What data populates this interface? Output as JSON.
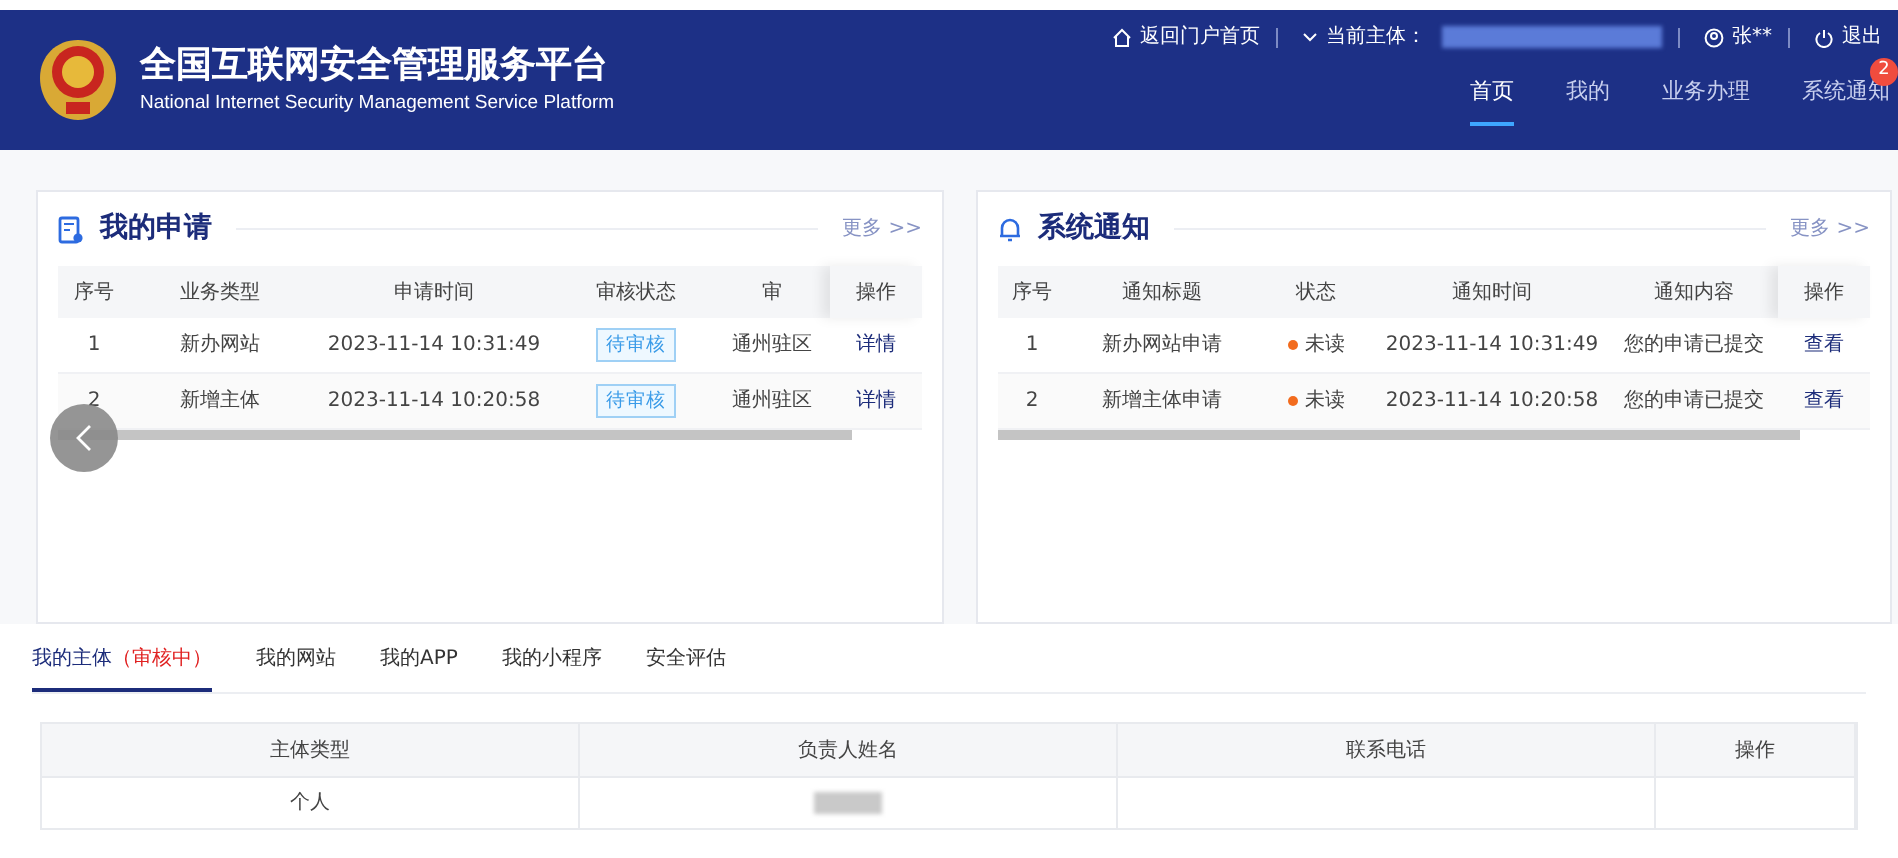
{
  "header": {
    "title": "全国互联网安全管理服务平台",
    "subtitle": "National Internet Security Management Service Platform",
    "top_links": [
      {
        "kind": "home",
        "label": "返回门户首页"
      },
      {
        "kind": "subject",
        "label": "当前主体："
      },
      {
        "kind": "user",
        "label": "张**"
      },
      {
        "kind": "logout",
        "label": "退出"
      }
    ],
    "nav": [
      {
        "label": "首页",
        "selected": true
      },
      {
        "label": "我的",
        "selected": false
      },
      {
        "label": "业务办理",
        "selected": false
      },
      {
        "label": "系统通知",
        "selected": false,
        "badge": "2"
      }
    ]
  },
  "applications": {
    "title": "我的申请",
    "more": "更多 >>",
    "columns": [
      "序号",
      "业务类型",
      "申请时间",
      "审核状态",
      "审",
      "操作"
    ],
    "rows": [
      {
        "cells": [
          "1",
          "新办网站",
          "2023-11-14 10:31:49",
          "待审核",
          "通州驻区",
          "详情"
        ]
      },
      {
        "cells": [
          "2",
          "新增主体",
          "2023-11-14 10:20:58",
          "待审核",
          "通州驻区",
          "详情"
        ]
      }
    ]
  },
  "notices": {
    "title": "系统通知",
    "more": "更多 >>",
    "columns": [
      "序号",
      "通知标题",
      "状态",
      "通知时间",
      "通知内容",
      "操作"
    ],
    "rows": [
      {
        "cells": [
          "1",
          "新办网站申请",
          "未读",
          "2023-11-14 10:31:49",
          "您的申请已提交",
          "查看"
        ],
        "color": "#f26b1d"
      },
      {
        "cells": [
          "2",
          "新增主体申请",
          "未读",
          "2023-11-14 10:20:58",
          "您的申请已提交",
          "查看"
        ],
        "color": "#f26b1d"
      }
    ]
  },
  "tabs": [
    {
      "label": "我的主体",
      "status": "（审核中）",
      "selected": true
    },
    {
      "label": "我的网站",
      "selected": false
    },
    {
      "label": "我的APP",
      "selected": false
    },
    {
      "label": "我的小程序",
      "selected": false
    },
    {
      "label": "安全评估",
      "selected": false
    }
  ],
  "subject_table": {
    "columns": [
      "主体类型",
      "负责人姓名",
      "联系电话",
      "操作"
    ],
    "rows": [
      {
        "cells": [
          {
            "kind": "text",
            "text": "个人"
          },
          {
            "kind": "redacted"
          },
          {
            "kind": "empty"
          },
          {
            "kind": "empty"
          }
        ]
      }
    ]
  }
}
